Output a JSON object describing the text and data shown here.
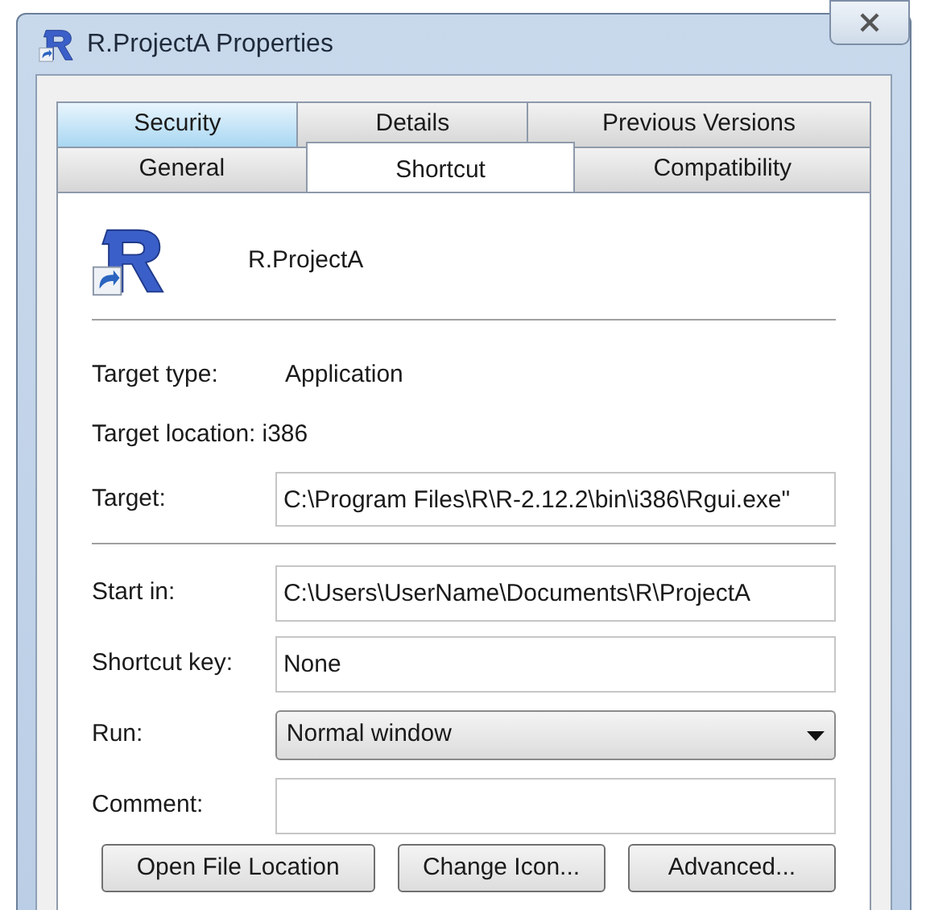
{
  "window": {
    "title": "R.ProjectA Properties"
  },
  "tab_rows": [
    [
      {
        "label": "Security",
        "selected": false,
        "highlighted": true
      },
      {
        "label": "Details",
        "selected": false,
        "highlighted": false
      },
      {
        "label": "Previous Versions",
        "selected": false,
        "highlighted": false
      }
    ],
    [
      {
        "label": "General",
        "selected": false,
        "highlighted": false
      },
      {
        "label": "Shortcut",
        "selected": true,
        "highlighted": false
      },
      {
        "label": "Compatibility",
        "selected": false,
        "highlighted": false
      }
    ]
  ],
  "shortcut_name": "R.ProjectA",
  "info": [
    {
      "label": "Target type:",
      "value": "Application"
    },
    {
      "label": "Target location:",
      "value": "i386"
    }
  ],
  "target": {
    "label": "Target:",
    "value": "C:\\Program Files\\R\\R-2.12.2\\bin\\i386\\Rgui.exe\""
  },
  "fields": [
    {
      "kind": "text",
      "label": "Start in:",
      "value": "C:\\Users\\UserName\\Documents\\R\\ProjectA"
    },
    {
      "kind": "text",
      "label": "Shortcut key:",
      "value": "None"
    },
    {
      "kind": "dropdown",
      "label": "Run:",
      "value": "Normal window"
    },
    {
      "kind": "text",
      "label": "Comment:"
    }
  ],
  "buttons": [
    "Open File Location",
    "Change Icon...",
    "Advanced..."
  ]
}
